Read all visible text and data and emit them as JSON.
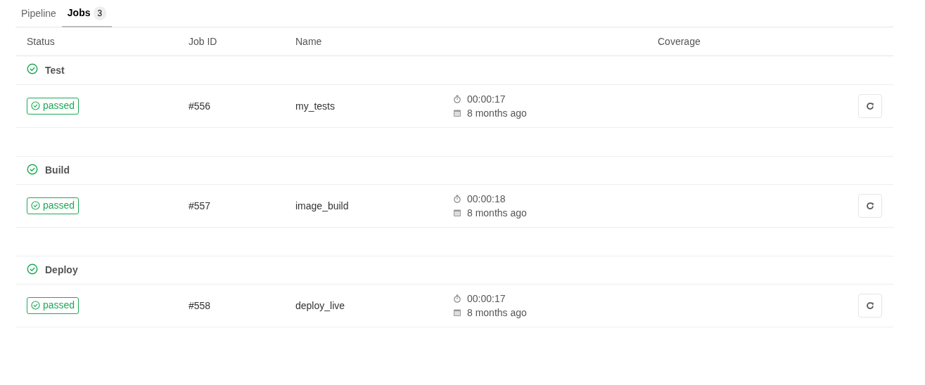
{
  "tabs": [
    {
      "label": "Pipeline",
      "selected": false
    },
    {
      "label": "Jobs",
      "count": "3",
      "selected": true
    }
  ],
  "table": {
    "columns": [
      "Status",
      "Job ID",
      "Name",
      "Coverage"
    ],
    "stages": [
      {
        "name": "Test",
        "jobs": [
          {
            "status": "passed",
            "id": "#556",
            "name": "my_tests",
            "duration": "00:00:17",
            "finished": "8 months ago"
          }
        ]
      },
      {
        "name": "Build",
        "jobs": [
          {
            "status": "passed",
            "id": "#557",
            "name": "image_build",
            "duration": "00:00:18",
            "finished": "8 months ago"
          }
        ]
      },
      {
        "name": "Deploy",
        "jobs": [
          {
            "status": "passed",
            "id": "#558",
            "name": "deploy_live",
            "duration": "00:00:17",
            "finished": "8 months ago"
          }
        ]
      }
    ]
  }
}
